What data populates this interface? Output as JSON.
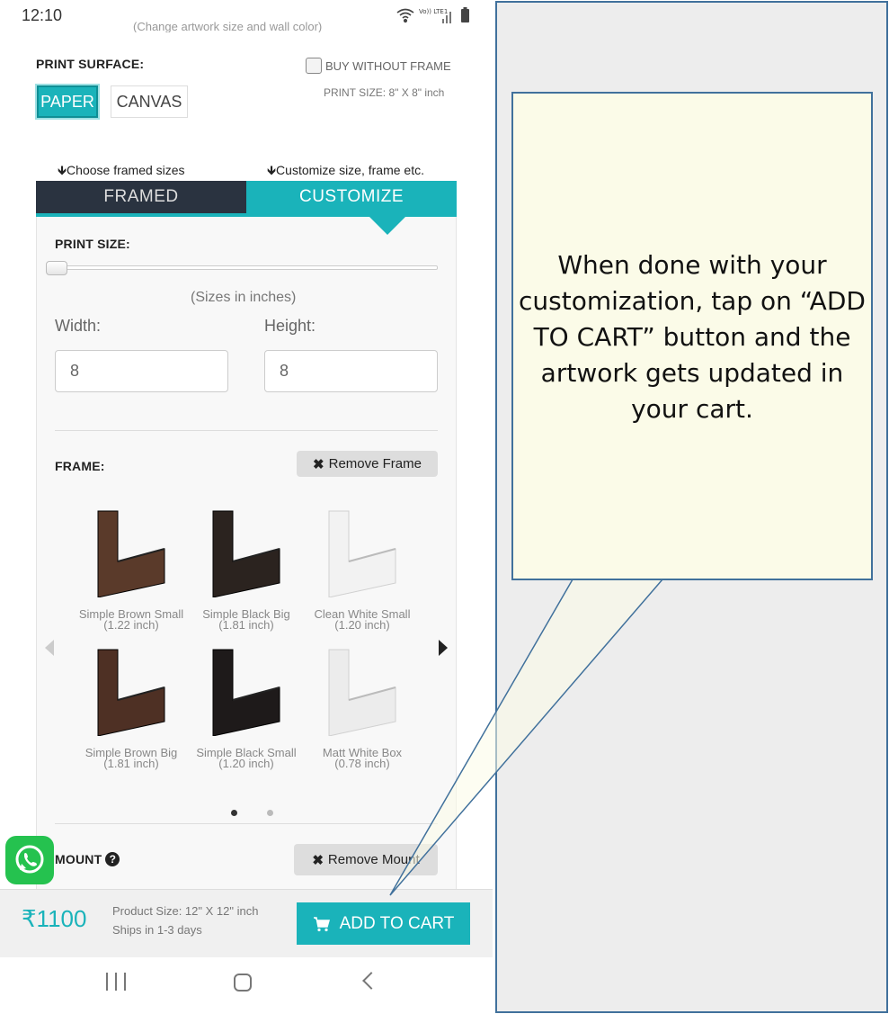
{
  "status_bar": {
    "time": "12:10",
    "network": "Vo)) LTE1"
  },
  "cut_off_text": "(Change artwork size and wall color)",
  "print_surface": {
    "label": "PRINT SURFACE:",
    "options": [
      "PAPER",
      "CANVAS"
    ],
    "selected": "PAPER",
    "buy_without_frame": "BUY WITHOUT FRAME",
    "buy_without_frame_checked": false,
    "print_size": "PRINT SIZE: 8\" X 8\" inch"
  },
  "hints": {
    "framed": "🡻Choose framed sizes",
    "customize": "🡻Customize size, frame etc."
  },
  "tabs": {
    "framed": "FRAMED",
    "customize": "CUSTOMIZE",
    "active": "CUSTOMIZE"
  },
  "print_size_section": {
    "label": "PRINT SIZE:",
    "slider_level": 0,
    "sizes_note": "(Sizes in inches)",
    "width_label": "Width:",
    "height_label": "Height:",
    "width_value": "8",
    "height_value": "8"
  },
  "frame_section": {
    "label": "FRAME:",
    "remove_label": "Remove Frame",
    "frames": [
      {
        "name": "Simple Brown Small",
        "size": "(1.22 inch)",
        "color": "#5a3a2a"
      },
      {
        "name": "Simple Black Big",
        "size": "(1.81 inch)",
        "color": "#2b231f"
      },
      {
        "name": "Clean White Small",
        "size": "(1.20 inch)",
        "color": "#f2f2f2"
      },
      {
        "name": "Simple Brown Big",
        "size": "(1.81 inch)",
        "color": "#4e3024"
      },
      {
        "name": "Simple Black Small",
        "size": "(1.20 inch)",
        "color": "#1e1a1a"
      },
      {
        "name": "Matt White Box",
        "size": "(0.78 inch)",
        "color": "#ececec"
      }
    ],
    "page_count": 2,
    "current_page": 1
  },
  "mount_section": {
    "label": "MOUNT",
    "remove_label": "Remove Mount"
  },
  "bottom_bar": {
    "price": "₹1100",
    "product_size": "Product Size: 12\" X 12\" inch",
    "ships": "Ships in 1-3 days",
    "add_to_cart": "ADD TO CART"
  },
  "callout": {
    "text": "When done with your customization, tap on “ADD TO CART” button and the artwork gets updated in your cart."
  },
  "colors": {
    "accent": "#1ab3ba",
    "dark_tab": "#2a3340",
    "callout_border": "#41719c",
    "callout_fill": "#fbfbe8"
  }
}
